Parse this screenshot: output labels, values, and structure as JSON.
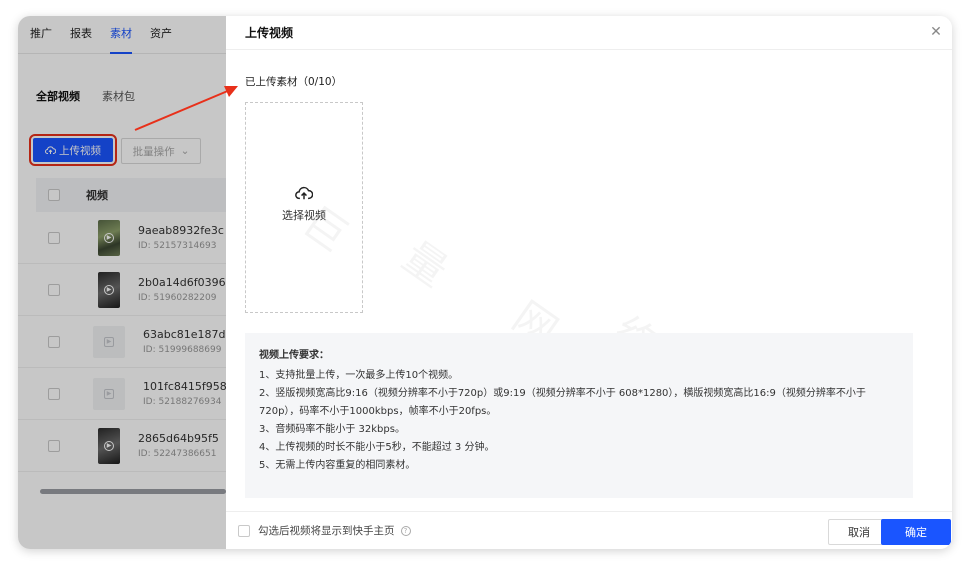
{
  "background": {
    "nav": [
      "推广",
      "报表",
      "素材",
      "资产"
    ],
    "nav_active": "素材",
    "subtabs": [
      "全部视频",
      "素材包"
    ],
    "upload_button": "上传视频",
    "batch_button": "批量操作",
    "table_header": "视频",
    "rows": [
      {
        "name": "9aeab8932fe3c",
        "id": "ID: 52157314693"
      },
      {
        "name": "2b0a14d6f0396",
        "id": "ID: 51960282209"
      },
      {
        "name": "63abc81e187d",
        "id": "ID: 51999688699"
      },
      {
        "name": "101fc8415f958",
        "id": "ID: 52188276934"
      },
      {
        "name": "2865d64b95f5",
        "id": "ID: 52247386651"
      }
    ]
  },
  "drawer": {
    "title": "上传视频",
    "uploaded_label": "已上传素材（0/10）",
    "select_video": "选择视频",
    "requirements_title": "视频上传要求：",
    "requirements": [
      "1、支持批量上传，一次最多上传10个视频。",
      "2、竖版视频宽高比9:16（视频分辨率不小于720p）或9:19（视频分辨率不小于 608*1280），横版视频宽高比16:9（视频分辨率不小于720p），码率不小于1000kbps，帧率不小于20fps。",
      "3、音频码率不能小于 32kbps。",
      "4、上传视频的时长不能小于5秒，不能超过 3 分钟。",
      "5、无需上传内容重复的相同素材。"
    ],
    "footer_checkbox_label": "勾选后视频将显示到快手主页",
    "cancel": "取消",
    "confirm": "确定"
  },
  "colors": {
    "primary": "#1a55ff",
    "annotation": "#e8301a"
  }
}
